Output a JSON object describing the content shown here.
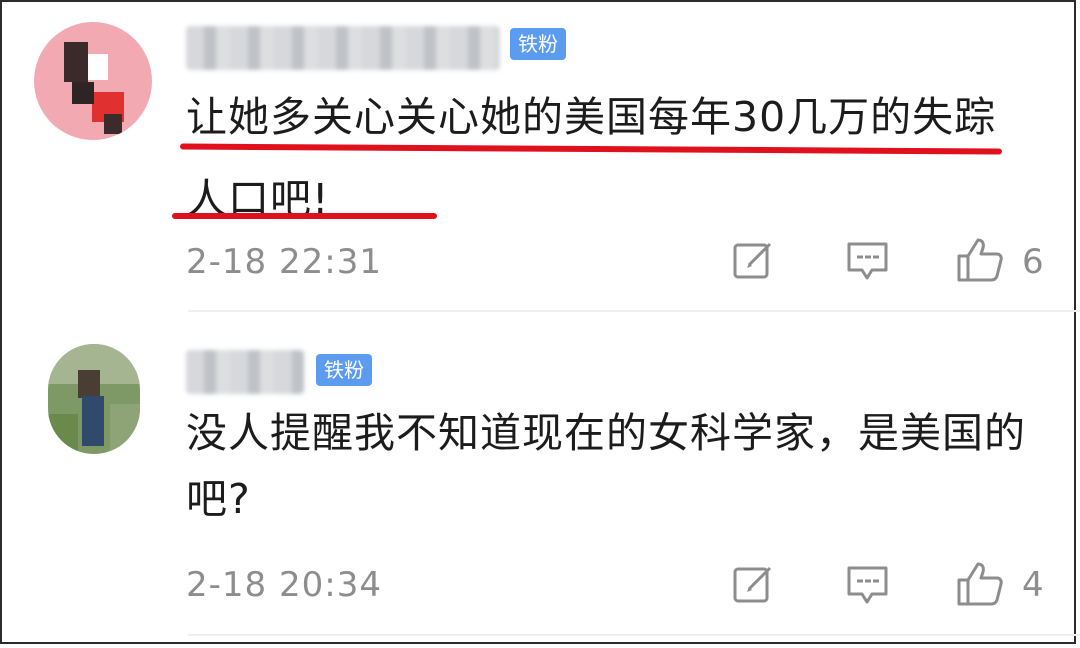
{
  "comments": [
    {
      "badge": "铁粉",
      "text": "让她多关心关心她的美国每年30几万的失踪人口吧!",
      "time": "2-18 22:31",
      "like_count": "6"
    },
    {
      "badge": "铁粉",
      "text": "没人提醒我不知道现在的女科学家，是美国的吧?",
      "time": "2-18 20:34",
      "like_count": "4"
    }
  ],
  "icons": {
    "edit": "edit-icon",
    "reply": "comment-icon",
    "like": "thumbs-up-icon"
  },
  "colors": {
    "underline": "#e0101d",
    "badge_bg": "#5b9bf0",
    "meta_text": "#8d8d8d"
  }
}
